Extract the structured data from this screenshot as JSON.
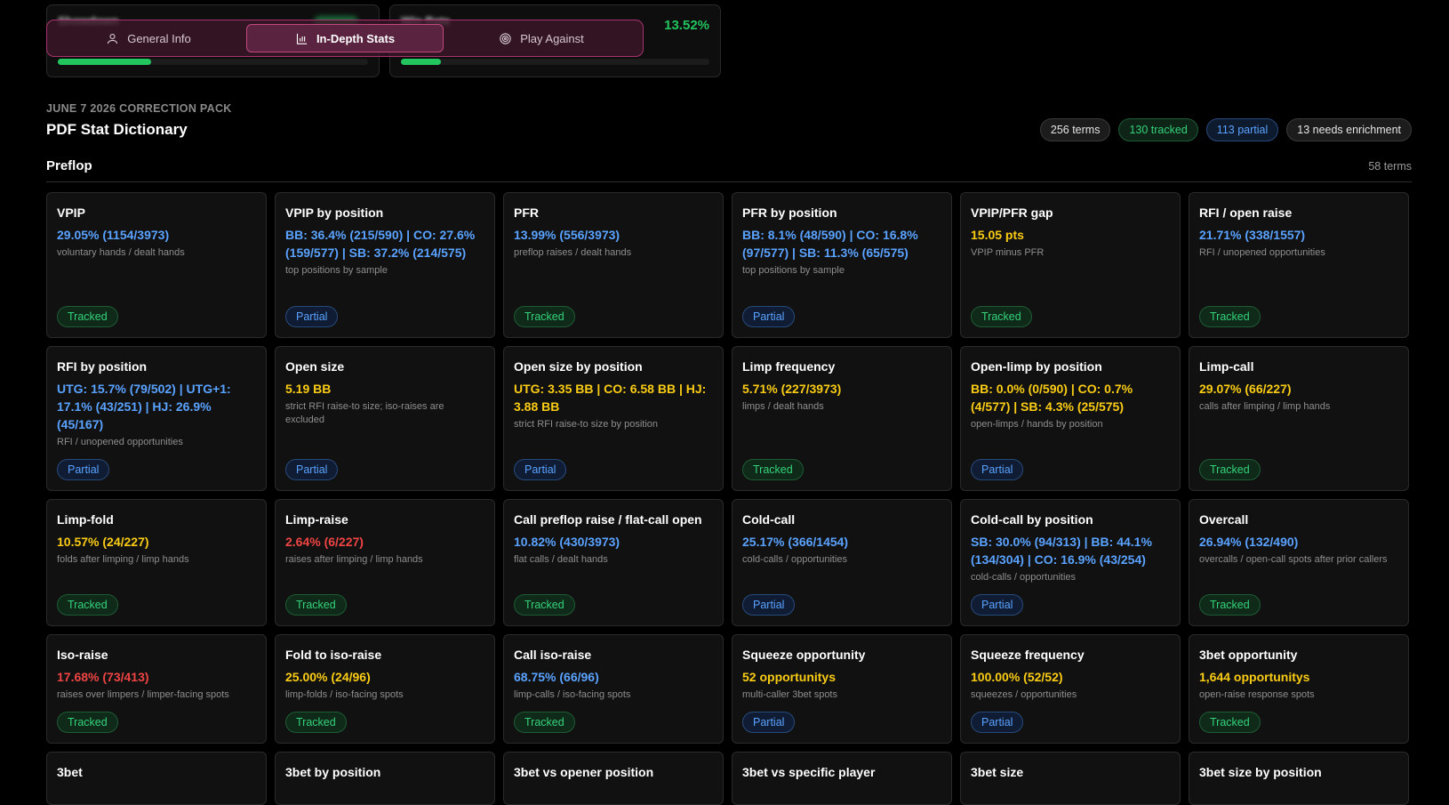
{
  "top_cards": {
    "left": {
      "label_blurred": "Showdown",
      "progress": 0.3
    },
    "right": {
      "label_blurred": "Win Rate",
      "value": "13.52%",
      "progress": 0.13
    }
  },
  "tabs": [
    {
      "label": "General Info",
      "icon": "user-icon",
      "active": false
    },
    {
      "label": "In-Depth Stats",
      "icon": "bar-chart-icon",
      "active": true
    },
    {
      "label": "Play Against",
      "icon": "target-icon",
      "active": false
    }
  ],
  "header": {
    "eyebrow": "JUNE 7 2026 CORRECTION PACK",
    "title": "PDF Stat Dictionary",
    "badges": [
      {
        "label": "256 terms",
        "tone": "neutral"
      },
      {
        "label": "130 tracked",
        "tone": "green"
      },
      {
        "label": "113 partial",
        "tone": "blue"
      },
      {
        "label": "13 needs enrichment",
        "tone": "neutral"
      }
    ]
  },
  "section": {
    "title": "Preflop",
    "count": "58 terms"
  },
  "colors": {
    "blue": "#5aa2ff",
    "yellow": "#facc15",
    "red": "#ef4444",
    "green": "#22c55e",
    "accent": "#c0487e"
  },
  "cards": [
    {
      "title": "VPIP",
      "value": "29.05% (1154/3973)",
      "tone": "blue",
      "sub": "voluntary hands / dealt hands",
      "status": "Tracked"
    },
    {
      "title": "VPIP by position",
      "value": "BB: 36.4% (215/590) | CO: 27.6% (159/577) | SB: 37.2% (214/575)",
      "tone": "blue",
      "sub": "top positions by sample",
      "status": "Partial"
    },
    {
      "title": "PFR",
      "value": "13.99% (556/3973)",
      "tone": "blue",
      "sub": "preflop raises / dealt hands",
      "status": "Tracked"
    },
    {
      "title": "PFR by position",
      "value": "BB: 8.1% (48/590) | CO: 16.8% (97/577) | SB: 11.3% (65/575)",
      "tone": "blue",
      "sub": "top positions by sample",
      "status": "Partial"
    },
    {
      "title": "VPIP/PFR gap",
      "value": "15.05 pts",
      "tone": "yellow",
      "sub": "VPIP minus PFR",
      "status": "Tracked"
    },
    {
      "title": "RFI / open raise",
      "value": "21.71% (338/1557)",
      "tone": "blue",
      "sub": "RFI / unopened opportunities",
      "status": "Tracked"
    },
    {
      "title": "RFI by position",
      "value": "UTG: 15.7% (79/502) | UTG+1: 17.1% (43/251) | HJ: 26.9% (45/167)",
      "tone": "blue",
      "sub": "RFI / unopened opportunities",
      "status": "Partial"
    },
    {
      "title": "Open size",
      "value": "5.19 BB",
      "tone": "yellow",
      "sub": "strict RFI raise-to size; iso-raises are excluded",
      "status": "Partial"
    },
    {
      "title": "Open size by position",
      "value": "UTG: 3.35 BB | CO: 6.58 BB | HJ: 3.88 BB",
      "tone": "yellow",
      "sub": "strict RFI raise-to size by position",
      "status": "Partial"
    },
    {
      "title": "Limp frequency",
      "value": "5.71% (227/3973)",
      "tone": "yellow",
      "sub": "limps / dealt hands",
      "status": "Tracked"
    },
    {
      "title": "Open-limp by position",
      "value": "BB: 0.0% (0/590) | CO: 0.7% (4/577) | SB: 4.3% (25/575)",
      "tone": "yellow",
      "sub": "open-limps / hands by position",
      "status": "Partial"
    },
    {
      "title": "Limp-call",
      "value": "29.07% (66/227)",
      "tone": "yellow",
      "sub": "calls after limping / limp hands",
      "status": "Tracked"
    },
    {
      "title": "Limp-fold",
      "value": "10.57% (24/227)",
      "tone": "yellow",
      "sub": "folds after limping / limp hands",
      "status": "Tracked"
    },
    {
      "title": "Limp-raise",
      "value": "2.64% (6/227)",
      "tone": "red",
      "sub": "raises after limping / limp hands",
      "status": "Tracked"
    },
    {
      "title": "Call preflop raise / flat-call open",
      "value": "10.82% (430/3973)",
      "tone": "blue",
      "sub": "flat calls / dealt hands",
      "status": "Tracked"
    },
    {
      "title": "Cold-call",
      "value": "25.17% (366/1454)",
      "tone": "blue",
      "sub": "cold-calls / opportunities",
      "status": "Partial"
    },
    {
      "title": "Cold-call by position",
      "value": "SB: 30.0% (94/313) | BB: 44.1% (134/304) | CO: 16.9% (43/254)",
      "tone": "blue",
      "sub": "cold-calls / opportunities",
      "status": "Partial"
    },
    {
      "title": "Overcall",
      "value": "26.94% (132/490)",
      "tone": "blue",
      "sub": "overcalls / open-call spots after prior callers",
      "status": "Tracked"
    },
    {
      "title": "Iso-raise",
      "value": "17.68% (73/413)",
      "tone": "red",
      "sub": "raises over limpers / limper-facing spots",
      "status": "Tracked"
    },
    {
      "title": "Fold to iso-raise",
      "value": "25.00% (24/96)",
      "tone": "yellow",
      "sub": "limp-folds / iso-facing spots",
      "status": "Tracked"
    },
    {
      "title": "Call iso-raise",
      "value": "68.75% (66/96)",
      "tone": "blue",
      "sub": "limp-calls / iso-facing spots",
      "status": "Tracked"
    },
    {
      "title": "Squeeze opportunity",
      "value": "52 opportunitys",
      "tone": "yellow",
      "sub": "multi-caller 3bet spots",
      "status": "Partial"
    },
    {
      "title": "Squeeze frequency",
      "value": "100.00% (52/52)",
      "tone": "yellow",
      "sub": "squeezes / opportunities",
      "status": "Partial"
    },
    {
      "title": "3bet opportunity",
      "value": "1,644 opportunitys",
      "tone": "yellow",
      "sub": "open-raise response spots",
      "status": "Tracked"
    },
    {
      "title": "3bet",
      "value": "",
      "tone": "blue",
      "sub": "",
      "status": ""
    },
    {
      "title": "3bet by position",
      "value": "",
      "tone": "blue",
      "sub": "",
      "status": ""
    },
    {
      "title": "3bet vs opener position",
      "value": "",
      "tone": "blue",
      "sub": "",
      "status": ""
    },
    {
      "title": "3bet vs specific player",
      "value": "",
      "tone": "blue",
      "sub": "",
      "status": ""
    },
    {
      "title": "3bet size",
      "value": "",
      "tone": "blue",
      "sub": "",
      "status": ""
    },
    {
      "title": "3bet size by position",
      "value": "",
      "tone": "blue",
      "sub": "",
      "status": ""
    }
  ]
}
